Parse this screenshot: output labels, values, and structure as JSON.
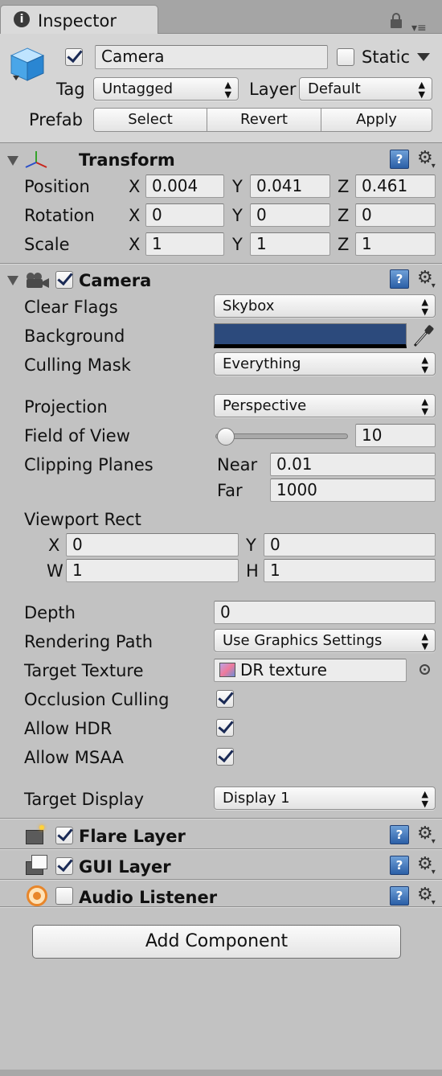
{
  "tab": {
    "title": "Inspector"
  },
  "header": {
    "object_name": "Camera",
    "static_label": "Static",
    "tag_label": "Tag",
    "tag_value": "Untagged",
    "layer_label": "Layer",
    "layer_value": "Default",
    "prefab_label": "Prefab",
    "prefab_buttons": [
      "Select",
      "Revert",
      "Apply"
    ]
  },
  "transform": {
    "title": "Transform",
    "rows": [
      {
        "label": "Position",
        "x": "0.004",
        "y": "0.041",
        "z": "0.461"
      },
      {
        "label": "Rotation",
        "x": "0",
        "y": "0",
        "z": "0"
      },
      {
        "label": "Scale",
        "x": "1",
        "y": "1",
        "z": "1"
      }
    ],
    "axis_labels": [
      "X",
      "Y",
      "Z"
    ]
  },
  "camera": {
    "title": "Camera",
    "clear_flags_label": "Clear Flags",
    "clear_flags_value": "Skybox",
    "background_label": "Background",
    "background_color": "#2c4a7c",
    "culling_mask_label": "Culling Mask",
    "culling_mask_value": "Everything",
    "projection_label": "Projection",
    "projection_value": "Perspective",
    "fov_label": "Field of View",
    "fov_value": "10",
    "clipping_label": "Clipping Planes",
    "near_label": "Near",
    "near_value": "0.01",
    "far_label": "Far",
    "far_value": "1000",
    "viewport_label": "Viewport Rect",
    "vp_x_label": "X",
    "vp_x": "0",
    "vp_y_label": "Y",
    "vp_y": "0",
    "vp_w_label": "W",
    "vp_w": "1",
    "vp_h_label": "H",
    "vp_h": "1",
    "depth_label": "Depth",
    "depth_value": "0",
    "rendering_path_label": "Rendering Path",
    "rendering_path_value": "Use Graphics Settings",
    "target_texture_label": "Target Texture",
    "target_texture_value": "DR texture",
    "occlusion_label": "Occlusion Culling",
    "hdr_label": "Allow HDR",
    "msaa_label": "Allow MSAA",
    "target_display_label": "Target Display",
    "target_display_value": "Display 1"
  },
  "components": {
    "flare": "Flare Layer",
    "gui": "GUI Layer",
    "audio": "Audio Listener"
  },
  "add_component_label": "Add Component",
  "help_glyph": "?",
  "arrows_glyph": "▲\n▼"
}
